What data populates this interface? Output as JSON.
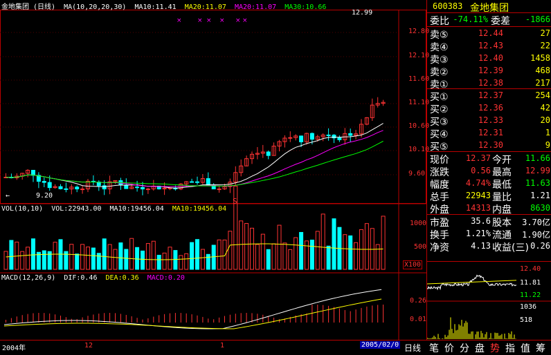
{
  "stock": {
    "code": "600383",
    "name": "金地集团",
    "chart_title": "金地集团 (日线)"
  },
  "legends": {
    "ma": [
      {
        "text": "MA(10,20,20,30)",
        "color": "#ffffff"
      },
      {
        "text": "MA10:11.41",
        "color": "#ffffff"
      },
      {
        "text": "MA20:11.07",
        "color": "#ffff00"
      },
      {
        "text": "MA20:11.07",
        "color": "#ff00ff"
      },
      {
        "text": "MA30:10.66",
        "color": "#00ff00"
      }
    ],
    "vol": [
      {
        "text": "VOL(10,10)",
        "color": "#ffffff"
      },
      {
        "text": "VOL:22943.00",
        "color": "#ffffff"
      },
      {
        "text": "MA10:19456.04",
        "color": "#ffffff"
      },
      {
        "text": "MA10:19456.04",
        "color": "#ffff00"
      }
    ],
    "macd": [
      {
        "text": "MACD(12,26,9)",
        "color": "#ffffff"
      },
      {
        "text": "DIF:0.46",
        "color": "#ffffff"
      },
      {
        "text": "DEA:0.36",
        "color": "#ffff00"
      },
      {
        "text": "MACD:0.20",
        "color": "#ff00ff"
      }
    ]
  },
  "annotations": {
    "high": "12.99",
    "low": "9.20",
    "mark": "S"
  },
  "axes": {
    "price": [
      "12.80",
      "12.10",
      "11.60",
      "11.10",
      "10.60",
      "10.10",
      "9.60"
    ],
    "volume": [
      "1000",
      "500"
    ],
    "volume_unit": "X100",
    "macd": [
      "0.26",
      "0.01"
    ],
    "date_left": "2004年",
    "date_mid1": "12",
    "date_mid2": "1",
    "date_right": "2005/02/0"
  },
  "quote": {
    "weibi_label": "委比",
    "weibi_val": "-74.11%",
    "weicha_label": "委差",
    "weicha_val": "-1866",
    "sell": [
      {
        "label": "卖⑤",
        "price": "12.44",
        "vol": "27"
      },
      {
        "label": "卖④",
        "price": "12.43",
        "vol": "22"
      },
      {
        "label": "卖③",
        "price": "12.40",
        "vol": "1458"
      },
      {
        "label": "卖②",
        "price": "12.39",
        "vol": "468"
      },
      {
        "label": "卖①",
        "price": "12.38",
        "vol": "217"
      }
    ],
    "buy": [
      {
        "label": "买①",
        "price": "12.37",
        "vol": "254"
      },
      {
        "label": "买②",
        "price": "12.36",
        "vol": "42"
      },
      {
        "label": "买③",
        "price": "12.33",
        "vol": "20"
      },
      {
        "label": "买④",
        "price": "12.31",
        "vol": "1"
      },
      {
        "label": "买⑤",
        "price": "12.30",
        "vol": "9"
      }
    ],
    "stats": [
      {
        "l1": "现价",
        "v1": "12.37",
        "c1": "#ff3333",
        "l2": "今开",
        "v2": "11.66",
        "c2": "#00ff00"
      },
      {
        "l1": "涨跌",
        "v1": "0.56",
        "c1": "#ff3333",
        "l2": "最高",
        "v2": "12.99",
        "c2": "#ff3333"
      },
      {
        "l1": "幅度",
        "v1": "4.74%",
        "c1": "#ff3333",
        "l2": "最低",
        "v2": "11.63",
        "c2": "#00ff00"
      },
      {
        "l1": "总手",
        "v1": "22943",
        "c1": "#ffff00",
        "l2": "量比",
        "v2": "1.21",
        "c2": "#ffffff"
      },
      {
        "l1": "外盘",
        "v1": "14313",
        "c1": "#ff3333",
        "l2": "内盘",
        "v2": "8630",
        "c2": "#00ff00"
      }
    ],
    "fund": [
      {
        "l1": "市盈",
        "v1": "35.6",
        "l2": "股本",
        "v2": "3.70亿"
      },
      {
        "l1": "换手",
        "v1": "1.21%",
        "l2": "流通",
        "v2": "1.90亿"
      },
      {
        "l1": "净资",
        "v1": "4.13",
        "l2": "收益(三)",
        "v2": "0.26"
      }
    ]
  },
  "mini": {
    "p1": "12.40",
    "p2": "11.81",
    "p3": "11.22",
    "v1": "1036",
    "v2": "518"
  },
  "tabs": {
    "daily": "日线",
    "t1": "笔",
    "t2": "价",
    "t3": "分",
    "t4": "盘",
    "t5": "势",
    "t6": "指",
    "t7": "值",
    "t8": "筹"
  },
  "colors": {
    "up": "#ff3333",
    "down": "#00ffff",
    "frame": "#bb0000"
  }
}
